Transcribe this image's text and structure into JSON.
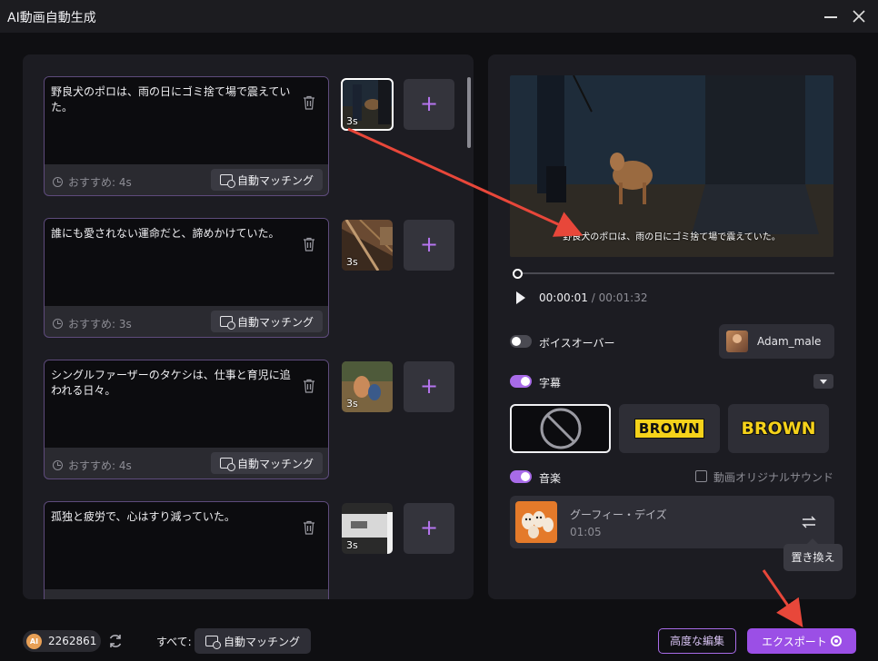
{
  "window": {
    "title": "AI動画自動生成",
    "minimize_icon": "minimize-icon",
    "close_icon": "close-icon"
  },
  "scenes": [
    {
      "text": "野良犬のポロは、雨の日にゴミ捨て場で震えていた。",
      "recommend": "おすすめ: 4s",
      "match_label": "自動マッチング",
      "thumb_duration": "3s",
      "selected": true
    },
    {
      "text": "誰にも愛されない運命だと、諦めかけていた。",
      "recommend": "おすすめ: 3s",
      "match_label": "自動マッチング",
      "thumb_duration": "3s",
      "selected": false
    },
    {
      "text": "シングルファーザーのタケシは、仕事と育児に追われる日々。",
      "recommend": "おすすめ: 4s",
      "match_label": "自動マッチング",
      "thumb_duration": "3s",
      "selected": false
    },
    {
      "text": "孤独と疲労で、心はすり減っていた。",
      "recommend": "",
      "match_label": "",
      "thumb_duration": "3s",
      "selected": false
    }
  ],
  "add_icon": "+",
  "preview": {
    "subtitle": "野良犬のポロは、雨の日にゴミ捨て場で震えていた。",
    "current_time": "00:00:01",
    "total_time": "/ 00:01:32",
    "progress": 0.01
  },
  "voiceover": {
    "label": "ボイスオーバー",
    "enabled": false,
    "voice_name": "Adam_male"
  },
  "subtitles": {
    "label": "字幕",
    "enabled": true,
    "styles": [
      "none",
      "BROWN",
      "BROWN"
    ]
  },
  "music": {
    "label": "音楽",
    "enabled": true,
    "original_sound_label": "動画オリジナルサウンド",
    "original_sound_checked": false,
    "track_title": "グーフィー・デイズ",
    "track_duration": "01:05",
    "replace_tooltip": "置き換え"
  },
  "bottom": {
    "credits": "2262861",
    "ai_badge": "AI",
    "all_label": "すべて:",
    "match_all_label": "自動マッチング",
    "advanced_edit_label": "高度な編集",
    "export_label": "エクスポート"
  },
  "colors": {
    "accent": "#9b4fe6",
    "toggle_on": "#a86be8",
    "annotation_arrow": "#e8473a"
  }
}
